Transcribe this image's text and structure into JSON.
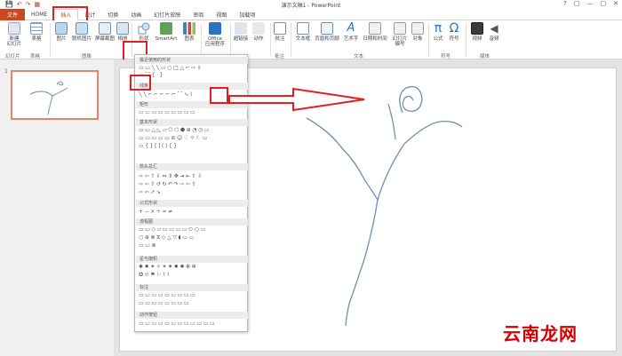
{
  "title_bar": {
    "qat": [
      "💾",
      "↶",
      "↷",
      "▦"
    ],
    "document_title": "演示文稿1 - PowerPoint",
    "window_controls": [
      "?",
      "□",
      "—",
      "□",
      "✕"
    ]
  },
  "tabs": [
    {
      "label": "文件"
    },
    {
      "label": "HOME"
    },
    {
      "label": "插入"
    },
    {
      "label": "设计"
    },
    {
      "label": "切换"
    },
    {
      "label": "动画"
    },
    {
      "label": "幻灯片放映"
    },
    {
      "label": "审阅"
    },
    {
      "label": "视图"
    },
    {
      "label": "加载项"
    }
  ],
  "ribbon": {
    "new_slide": "新建\n幻灯片",
    "table": "表格",
    "picture": "图片",
    "online_picture": "联机图片",
    "screenshot": "屏幕截图",
    "album": "相册",
    "shapes": "形状",
    "smartart": "SmartArt",
    "chart": "图表",
    "office_apps": "Office\n应用程序",
    "hyperlink": "超链接",
    "action": "动作",
    "comment": "批注",
    "textbox": "文本框",
    "header_footer": "页眉和页脚",
    "wordart": "艺术字",
    "date_time": "日期和时间",
    "slide_number": "幻灯片\n编号",
    "object": "对象",
    "equation": "公式",
    "symbol": "符号",
    "video": "视频",
    "audio": "音频",
    "groups": {
      "slides": "幻灯片",
      "tables": "表格",
      "images": "图像",
      "comments": "批注",
      "text": "文本",
      "symbols": "符号",
      "media": "媒体"
    }
  },
  "slide_pane": {
    "slide_number": "1"
  },
  "shapes_menu": {
    "sections": [
      "最近使用的形状",
      "线条",
      "矩形",
      "基本形状",
      "箭头总汇",
      "公式形状",
      "流程图",
      "星与旗帜",
      "标注",
      "动作按钮"
    ],
    "rows": {
      "recent_1": "▭▭╲╲▭○□△⌐⇨⇩",
      "recent_2": "☆⌒{ }",
      "lines": "╲╲⌐⌐⌐⌐⌐⌒∿⌇",
      "rect": "▭▭▭▭▭▭▭▭▭",
      "basic_1": "▭▭△◺▱⬠⬡⬢⊕◔◷▭",
      "basic_2": "▭▭▭▭▭⊘☺♡☼☾▭",
      "basic_3": "▭{}[](){}",
      "arrows_1": "⇨⇦⇧⇩⇔⇕✥⇥⇤⇧⇩",
      "arrows_2": "⇨⇦⇧↺↻↶↷⇨⇦⇧",
      "arrows_3": "⇨⇦↗↘",
      "eq": "+−×÷=≠",
      "flow_1": "▭▭◇▱▭▭▭▭⬭○▭",
      "flow_2": "○⊕⊗⧖◇△▽◖▭▭",
      "flow_3": "▭▭⊗",
      "stars_1": "✱✸✦✧✶✷✹✺✻✼",
      "stars_2": "✪✫⚑⚐⌇⌇",
      "callouts_1": "▭▭▭▭▭▭▭▭▭",
      "callouts_2": "▭▭▭▭▭▭▭▭",
      "actions": "▭▭▭▭▭▭▭▭▭▭▭▭"
    }
  },
  "watermark": "云南龙网",
  "colors": {
    "accent": "#c84a23",
    "highlight": "#e02020",
    "stroke": "#6d8fb4"
  }
}
